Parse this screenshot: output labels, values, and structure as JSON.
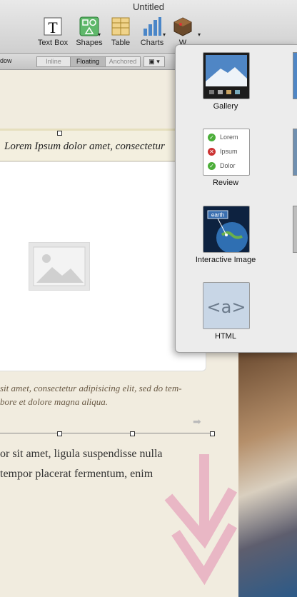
{
  "window": {
    "title": "Untitled"
  },
  "toolbar": {
    "items": [
      {
        "label": "Text Box",
        "icon": "text-box-icon"
      },
      {
        "label": "Shapes",
        "icon": "shapes-icon"
      },
      {
        "label": "Table",
        "icon": "table-icon"
      },
      {
        "label": "Charts",
        "icon": "charts-icon"
      },
      {
        "label": "W",
        "icon": "widgets-icon"
      }
    ]
  },
  "format_bar": {
    "left_text": "dow",
    "wrap_options": [
      "Inline",
      "Floating",
      "Anchored"
    ],
    "selected": "Floating"
  },
  "document": {
    "banner_text": "Lorem Ipsum dolor amet, consectetur",
    "caption_line1": "sit amet, consectetur adipisicing elit, sed do tem-",
    "caption_line2": "bore et dolore magna aliqua.",
    "body_line1": "or sit amet, ligula suspendisse nulla",
    "body_line2": "tempor placerat fermentum, enim"
  },
  "widgets_menu": {
    "items": [
      {
        "label": "Gallery",
        "icon": "gallery-icon"
      },
      {
        "label": "Review",
        "icon": "review-icon",
        "rows": [
          "Lorem",
          "Ipsum",
          "Dolor"
        ]
      },
      {
        "label": "Interactive Image",
        "icon": "interactive-image-icon",
        "badge": "earth"
      },
      {
        "label": "HTML",
        "icon": "html-icon",
        "glyph": "<a>"
      }
    ]
  },
  "colors": {
    "accent_blue": "#3a6fb0",
    "check_green": "#4cae3a",
    "cross_red": "#cc3333"
  }
}
